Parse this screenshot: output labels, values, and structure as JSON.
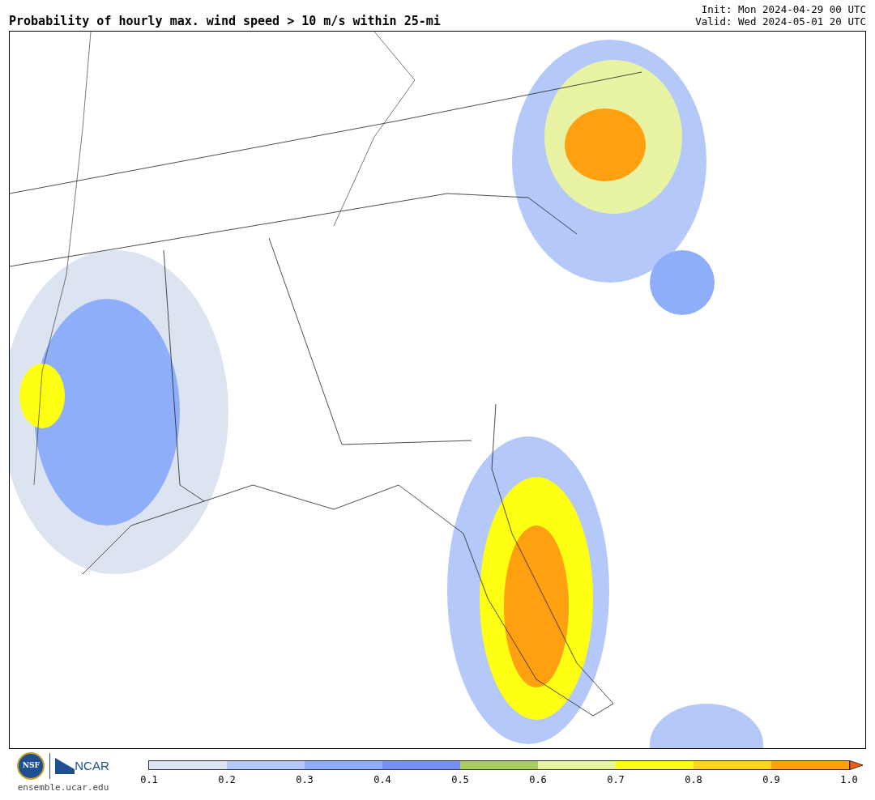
{
  "title": "Probability of hourly max. wind speed > 10 m/s within 25-mi",
  "init": "Init: Mon 2024-04-29 00 UTC",
  "valid": "Valid: Wed 2024-05-01 20 UTC",
  "logos": {
    "nsf": "NSF",
    "ncar": "NCAR"
  },
  "website": "ensemble.ucar.edu",
  "colorbar": {
    "segments": [
      {
        "color": "#dbe4f0"
      },
      {
        "color": "#b4c8fa"
      },
      {
        "color": "#8eaefa"
      },
      {
        "color": "#7790f5"
      },
      {
        "color": "#a8cb62"
      },
      {
        "color": "#e8f4a4"
      },
      {
        "color": "#ffff14"
      },
      {
        "color": "#ffd424"
      },
      {
        "color": "#ffa010"
      },
      {
        "kind": "arrow",
        "color": "#ff5a10"
      }
    ],
    "ticks": [
      "0.1",
      "0.2",
      "0.3",
      "0.4",
      "0.5",
      "0.6",
      "0.7",
      "0.8",
      "0.9",
      "1.0"
    ]
  }
}
